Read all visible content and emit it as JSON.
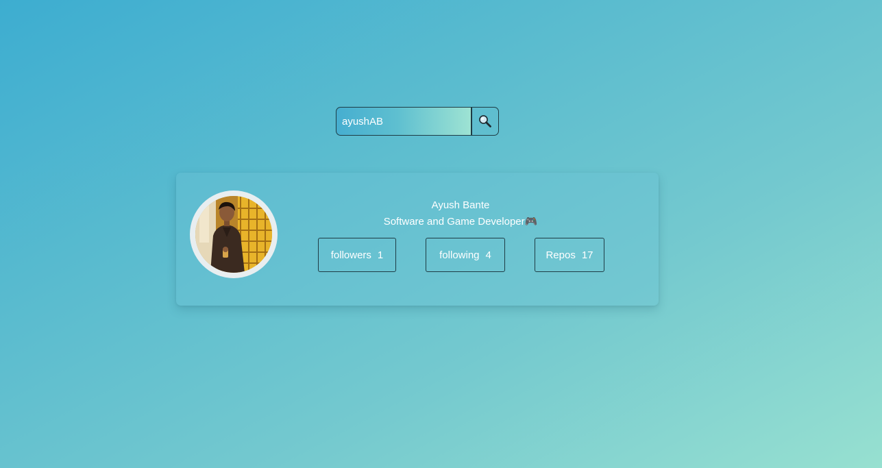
{
  "search": {
    "value": "ayushAB",
    "button_icon": "search-icon"
  },
  "profile": {
    "name": "Ayush Bante",
    "bio": "Software and Game Developer🎮",
    "avatar": "user-avatar-photo",
    "stats": {
      "followers_label": "followers",
      "followers_count": "1",
      "following_label": "following",
      "following_count": "4",
      "repos_label": "Repos",
      "repos_count": "17"
    }
  },
  "colors": {
    "background_start": "#3dadd0",
    "background_end": "#97e0d0",
    "text": "#ffffff",
    "border": "#1e3b44"
  }
}
